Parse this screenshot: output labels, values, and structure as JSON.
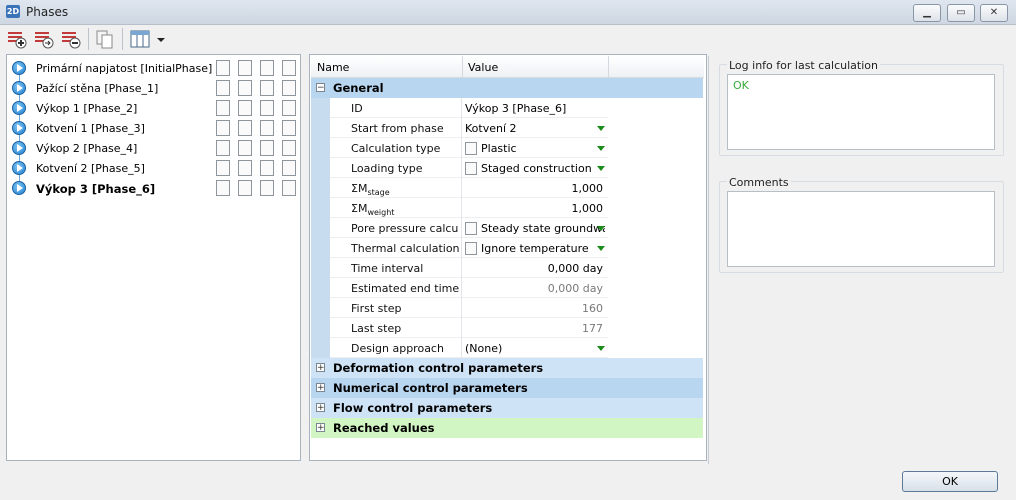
{
  "window": {
    "app_icon_text": "2D",
    "title": "Phases",
    "minimize_icon": "minimize-icon",
    "maximize_icon": "maximize-icon",
    "close_icon": "close-icon"
  },
  "toolbar": {
    "buttons": [
      "add-phase-icon",
      "insert-phase-icon",
      "delete-phase-icon",
      "copy-phase-icon",
      "columns-icon"
    ]
  },
  "phases": [
    {
      "label": "Primární napjatost [InitialPhase]",
      "bold": false
    },
    {
      "label": "Pažící stěna [Phase_1]",
      "bold": false
    },
    {
      "label": "Výkop 1 [Phase_2]",
      "bold": false
    },
    {
      "label": "Kotvení 1 [Phase_3]",
      "bold": false
    },
    {
      "label": "Výkop 2 [Phase_4]",
      "bold": false
    },
    {
      "label": "Kotvení 2 [Phase_5]",
      "bold": false
    },
    {
      "label": "Výkop 3 [Phase_6]",
      "bold": true
    }
  ],
  "grid": {
    "header_name": "Name",
    "header_value": "Value",
    "general": {
      "label": "General",
      "expander": "−",
      "rows": [
        {
          "name": "ID",
          "value": "Výkop 3 [Phase_6]",
          "align": "left",
          "dropdown": false,
          "icon": null
        },
        {
          "name": "Start from phase",
          "value": "Kotvení 2",
          "align": "left",
          "dropdown": true,
          "icon": null
        },
        {
          "name": "Calculation type",
          "value": "Plastic",
          "align": "left",
          "dropdown": true,
          "icon": "plastic-icon"
        },
        {
          "name": "Loading type",
          "value": "Staged construction",
          "align": "left",
          "dropdown": true,
          "icon": "staged-construction-icon"
        },
        {
          "name": "ΣM",
          "sub": "stage",
          "value": "1,000",
          "align": "right",
          "dropdown": false,
          "icon": null
        },
        {
          "name": "ΣM",
          "sub": "weight",
          "value": "1,000",
          "align": "right",
          "dropdown": false,
          "icon": null
        },
        {
          "name": "Pore pressure calculation type",
          "value": "Steady state groundwater flow",
          "align": "left",
          "dropdown": true,
          "icon": "groundwater-icon"
        },
        {
          "name": "Thermal calculation type",
          "value": "Ignore temperature",
          "align": "left",
          "dropdown": true,
          "icon": "temperature-icon"
        },
        {
          "name": "Time interval",
          "value": "0,000 day",
          "align": "right",
          "dropdown": false,
          "icon": null
        },
        {
          "name": "Estimated end time",
          "value": "0,000 day",
          "align": "right",
          "gray": true,
          "dropdown": false,
          "icon": null
        },
        {
          "name": "First step",
          "value": "160",
          "align": "right",
          "gray": true,
          "dropdown": false,
          "icon": null
        },
        {
          "name": "Last step",
          "value": "177",
          "align": "right",
          "gray": true,
          "dropdown": false,
          "icon": null
        },
        {
          "name": "Design approach",
          "value": "(None)",
          "align": "left",
          "dropdown": true,
          "icon": null
        }
      ]
    },
    "categories": [
      {
        "label": "Deformation control parameters",
        "expander": "+",
        "color": "#cfe3f6"
      },
      {
        "label": "Numerical control parameters",
        "expander": "+",
        "color": "#b9d6f0"
      },
      {
        "label": "Flow control parameters",
        "expander": "+",
        "color": "#cfe3f6"
      },
      {
        "label": "Reached values",
        "expander": "+",
        "color": "#d2f5c4"
      }
    ]
  },
  "log": {
    "title": "Log info for last calculation",
    "text": "OK",
    "text_color": "#3aa93a"
  },
  "comments": {
    "title": "Comments",
    "text": ""
  },
  "ok_button": "OK"
}
